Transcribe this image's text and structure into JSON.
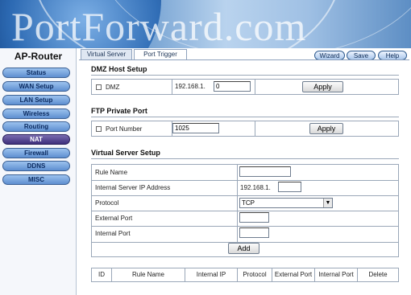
{
  "banner": {
    "watermark": "PortForward.com"
  },
  "sidebar": {
    "title": "AP-Router",
    "items": [
      {
        "label": "Status"
      },
      {
        "label": "WAN Setup"
      },
      {
        "label": "LAN Setup"
      },
      {
        "label": "Wireless"
      },
      {
        "label": "Routing"
      },
      {
        "label": "NAT"
      },
      {
        "label": "Firewall"
      },
      {
        "label": "DDNS"
      },
      {
        "label": "MISC"
      }
    ]
  },
  "tabs": [
    {
      "label": "Virtual Server"
    },
    {
      "label": "Port Trigger"
    }
  ],
  "toolbar": {
    "wizard": "Wizard",
    "save": "Save",
    "help": "Help"
  },
  "dmz": {
    "section_title": "DMZ Host Setup",
    "checkbox_label": "DMZ",
    "ip_prefix": "192.168.1.",
    "ip_last": "0",
    "apply": "Apply"
  },
  "ftp": {
    "section_title": "FTP Private Port",
    "checkbox_label": "Port Number",
    "port_value": "1025",
    "apply": "Apply"
  },
  "vserver": {
    "section_title": "Virtual Server Setup",
    "fields": {
      "rule_name": "Rule Name",
      "internal_ip": "Internal Server IP Address",
      "ip_prefix": "192.168.1.",
      "protocol": "Protocol",
      "protocol_value": "TCP",
      "external_port": "External Port",
      "internal_port": "Internal Port"
    },
    "add": "Add",
    "columns": [
      "ID",
      "Rule Name",
      "Internal IP",
      "Protocol",
      "External Port",
      "Internal Port",
      "Delete"
    ]
  }
}
